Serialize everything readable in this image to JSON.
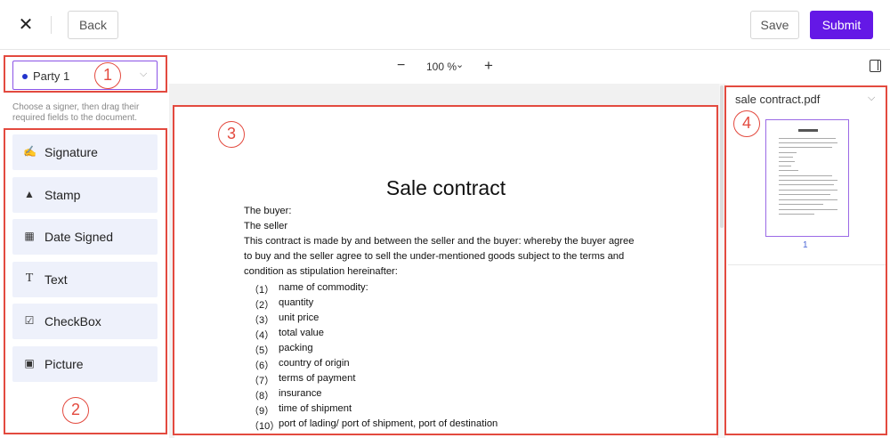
{
  "topbar": {
    "close_icon": "close-icon",
    "back_label": "Back",
    "save_label": "Save",
    "submit_label": "Submit",
    "accent_color": "#6418e6"
  },
  "zoom": {
    "minus": "−",
    "value": "100 %",
    "plus": "+"
  },
  "signer": {
    "selected": "Party 1",
    "hint": "Choose a signer, then drag their required fields to the document."
  },
  "fields": [
    {
      "label": "Signature",
      "icon": "pen-icon"
    },
    {
      "label": "Stamp",
      "icon": "stamp-icon"
    },
    {
      "label": "Date Signed",
      "icon": "calendar-icon"
    },
    {
      "label": "Text",
      "icon": "text-icon"
    },
    {
      "label": "CheckBox",
      "icon": "checkbox-icon"
    },
    {
      "label": "Picture",
      "icon": "picture-icon"
    }
  ],
  "document": {
    "title": "Sale contract",
    "lines": [
      "The buyer:",
      "The seller",
      "This contract is made by and between the seller and the buyer: whereby the buyer agree",
      "to buy and the seller agree to sell the under-mentioned goods subject to the terms and",
      "condition as stipulation hereinafter:"
    ],
    "list": [
      {
        "num": "（1）",
        "text": "name of commodity:"
      },
      {
        "num": "（2）",
        "text": "quantity"
      },
      {
        "num": "（3）",
        "text": "unit price"
      },
      {
        "num": "（4）",
        "text": "total value"
      },
      {
        "num": "（5）",
        "text": "packing"
      },
      {
        "num": "（6）",
        "text": "country of origin"
      },
      {
        "num": "（7）",
        "text": "terms of payment"
      },
      {
        "num": "（8）",
        "text": "insurance"
      },
      {
        "num": "（9）",
        "text": "time of shipment"
      },
      {
        "num": "（10）",
        "text": "port of lading/ port of shipment, port of destination"
      }
    ]
  },
  "files": {
    "name": "sale contract.pdf",
    "page_number": "1"
  },
  "annotations": [
    "1",
    "2",
    "3",
    "4"
  ],
  "highlight_color": "#e34a3f"
}
